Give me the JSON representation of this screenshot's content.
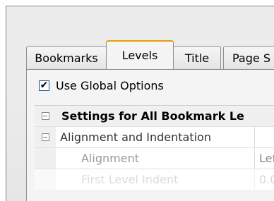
{
  "tabs": [
    {
      "label": "Bookmarks"
    },
    {
      "label": "Levels"
    },
    {
      "label": "Title"
    },
    {
      "label": "Page S"
    }
  ],
  "use_global_options": {
    "checked": true,
    "label": "Use Global Options",
    "mark": "✔"
  },
  "grid": {
    "collapse_glyph": "−",
    "header": "Settings for All Bookmark Le",
    "group": "Alignment and Indentation",
    "rows": [
      {
        "name": "Alignment",
        "value": "Lef"
      },
      {
        "name": "First Level Indent",
        "value": "0.0"
      }
    ]
  }
}
